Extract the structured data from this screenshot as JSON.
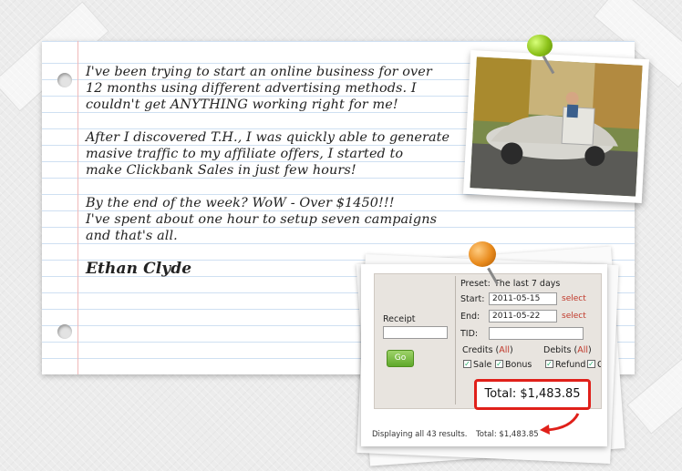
{
  "testimonial": {
    "paragraphs": [
      "I've been trying to start an online business for over\n12 months using different advertising methods. I\ncouldn't get ANYTHING working right for me!",
      "After I discovered T.H., I was quickly able to generate\nmasive traffic to my affiliate offers, I started to\nmake Clickbank Sales in just few hours!",
      "By the end of the week? WoW - Over $1450!!!\nI've spent about one hour to setup seven campaigns\nand that's all."
    ],
    "signature": "Ethan Clyde"
  },
  "report": {
    "preset_label": "Preset:",
    "preset_value": "The last 7 days",
    "start_label": "Start:",
    "start_value": "2011-05-15",
    "end_label": "End:",
    "end_value": "2011-05-22",
    "select_label": "select",
    "tid_label": "TID:",
    "receipt_label": "Receipt",
    "go_label": "Go",
    "credits_label": "Credits",
    "debits_label": "Debits",
    "all_label": "All",
    "sale_label": "Sale",
    "bonus_label": "Bonus",
    "refund_label": "Refund",
    "c_label": "C",
    "highlight_total": "Total: $1,483.85",
    "results_text": "Displaying all 43 results.",
    "footer_total": "Total: $1,483.85"
  },
  "colors": {
    "pin_green": "#8cc21a",
    "pin_orange": "#e88a1c",
    "highlight_red": "#e0201a",
    "go_green": "#5fa82a"
  },
  "icons": [
    "pushpin-icon",
    "pushpin-icon",
    "arrow-icon"
  ]
}
